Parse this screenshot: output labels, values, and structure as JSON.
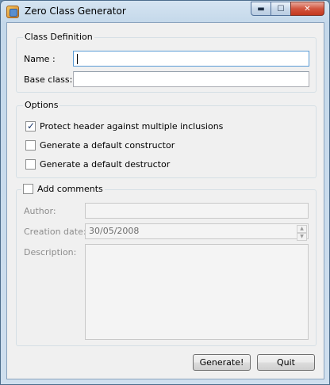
{
  "window": {
    "title": "Zero Class Generator"
  },
  "class_definition": {
    "title": "Class Definition",
    "name_label": "Name :",
    "name_value": "",
    "base_label": "Base class:",
    "base_value": ""
  },
  "options": {
    "title": "Options",
    "items": [
      {
        "label": "Protect header against multiple inclusions",
        "checked": true
      },
      {
        "label": "Generate a default constructor",
        "checked": false
      },
      {
        "label": "Generate a default destructor",
        "checked": false
      }
    ]
  },
  "comments": {
    "title": "Add comments",
    "checked": false,
    "author_label": "Author:",
    "author_value": "",
    "date_label": "Creation date:",
    "date_value": "30/05/2008",
    "description_label": "Description:",
    "description_value": ""
  },
  "buttons": {
    "generate": "Generate!",
    "quit": "Quit"
  },
  "icons": {
    "app": "class-generator-icon",
    "minimize": "minimize-icon",
    "maximize": "maximize-icon",
    "close": "close-icon",
    "check": "check-icon"
  },
  "colors": {
    "focus": "#5a9bd5",
    "close_button": "#c4381e"
  }
}
